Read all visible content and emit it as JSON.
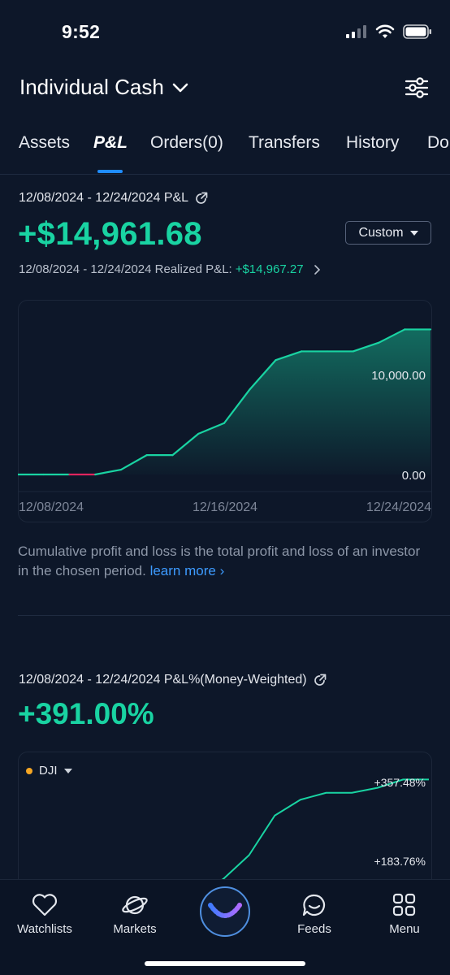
{
  "status_bar": {
    "time": "9:52"
  },
  "header": {
    "title": "Individual Cash"
  },
  "tabs": [
    {
      "label": "Assets",
      "active": false
    },
    {
      "label": "P&L",
      "active": true
    },
    {
      "label": "Orders(0)",
      "active": false
    },
    {
      "label": "Transfers",
      "active": false
    },
    {
      "label": "History",
      "active": false
    },
    {
      "label": "Do",
      "active": false
    }
  ],
  "pnl": {
    "range_label": "12/08/2024 - 12/24/2024 P&L",
    "value": "+$14,961.68",
    "period_button": "Custom",
    "realized_label": "12/08/2024 - 12/24/2024 Realized P&L:",
    "realized_value": "+$14,967.27",
    "explanation": "Cumulative profit and loss is the total profit and loss of an investor in the chosen period.",
    "learn_more": "learn more"
  },
  "pnl_pct": {
    "range_label": "12/08/2024 - 12/24/2024 P&L%(Money-Weighted)",
    "value": "+391.00%",
    "benchmark": "DJI"
  },
  "bottom_nav": [
    {
      "label": "Watchlists",
      "icon": "heart-icon"
    },
    {
      "label": "Markets",
      "icon": "planet-icon"
    },
    {
      "label": "",
      "icon": "smile-logo-icon"
    },
    {
      "label": "Feeds",
      "icon": "chat-smile-icon"
    },
    {
      "label": "Menu",
      "icon": "grid-icon"
    }
  ],
  "colors": {
    "positive": "#19d3a2",
    "negative": "#e0245e",
    "accent": "#1f8cff",
    "background": "#0d1729",
    "benchmark_dot": "#f5a623"
  },
  "chart_data": [
    {
      "type": "area",
      "x": [
        "12/08/2024",
        "12/09/2024",
        "12/10/2024",
        "12/11/2024",
        "12/12/2024",
        "12/13/2024",
        "12/14/2024",
        "12/15/2024",
        "12/16/2024",
        "12/17/2024",
        "12/18/2024",
        "12/19/2024",
        "12/20/2024",
        "12/21/2024",
        "12/22/2024",
        "12/23/2024",
        "12/24/2024"
      ],
      "values": [
        0,
        0,
        -20,
        -20,
        500,
        2000,
        2000,
        4200,
        5300,
        8800,
        11800,
        12700,
        12700,
        12700,
        13600,
        14961.68,
        14961.68
      ],
      "xticks": [
        "12/08/2024",
        "12/16/2024",
        "12/24/2024"
      ],
      "yticks": [
        "10,000.00",
        "0.00"
      ],
      "ylim": [
        0,
        15500
      ],
      "grid": false
    },
    {
      "type": "line",
      "values_pct": [
        0,
        0,
        0,
        0,
        10,
        60,
        60,
        100,
        140,
        200,
        300,
        340,
        357.48,
        357.48,
        370,
        391,
        391
      ],
      "yticks": [
        "+357.48%",
        "+183.76%"
      ],
      "benchmark": "DJI",
      "grid": false
    }
  ]
}
